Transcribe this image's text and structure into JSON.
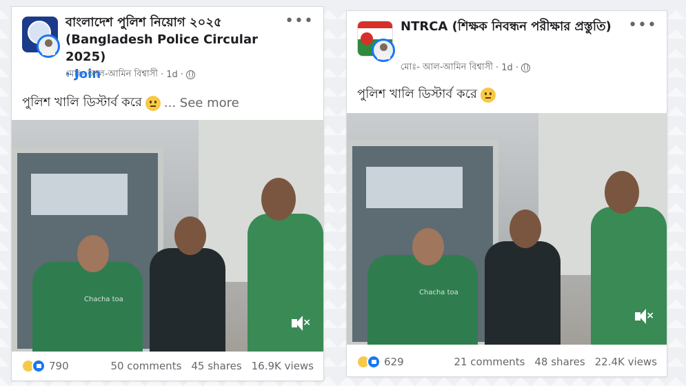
{
  "posts": [
    {
      "group_name": "বাংলাদেশ পুলিশ নিয়োগ ২০২৫ (Bangladesh Police Circular 2025)",
      "join_label": "· Join",
      "author": "মোঃ- আল-আমিন বিশ্বাসী",
      "time": "· 1d ·",
      "caption": "পুলিশ খালি ডিস্টার্ব করে",
      "see_more": "... See more",
      "video_watermark": "Chacha toa",
      "reaction_count": "790",
      "comments": "50 comments",
      "shares": "45 shares",
      "views": "16.9K views"
    },
    {
      "group_name": "NTRCA (শিক্ষক নিবন্ধন পরীক্ষার প্রস্তুতি)",
      "author": "মোঃ- আল-আমিন বিশ্বাসী",
      "time": "· 1d ·",
      "caption": "পুলিশ খালি ডিস্টার্ব করে",
      "video_watermark": "Chacha toa",
      "reaction_count": "629",
      "comments": "21 comments",
      "shares": "48 shares",
      "views": "22.4K views"
    }
  ],
  "more_label": "•••",
  "colors": {
    "link": "#1877f2",
    "text": "#1c1e21",
    "muted": "#65676b"
  },
  "icons": [
    "group-avatar-icon",
    "globe-icon",
    "more-options-icon",
    "emoji-icon",
    "mute-icon",
    "haha-reaction-icon",
    "like-reaction-icon"
  ]
}
